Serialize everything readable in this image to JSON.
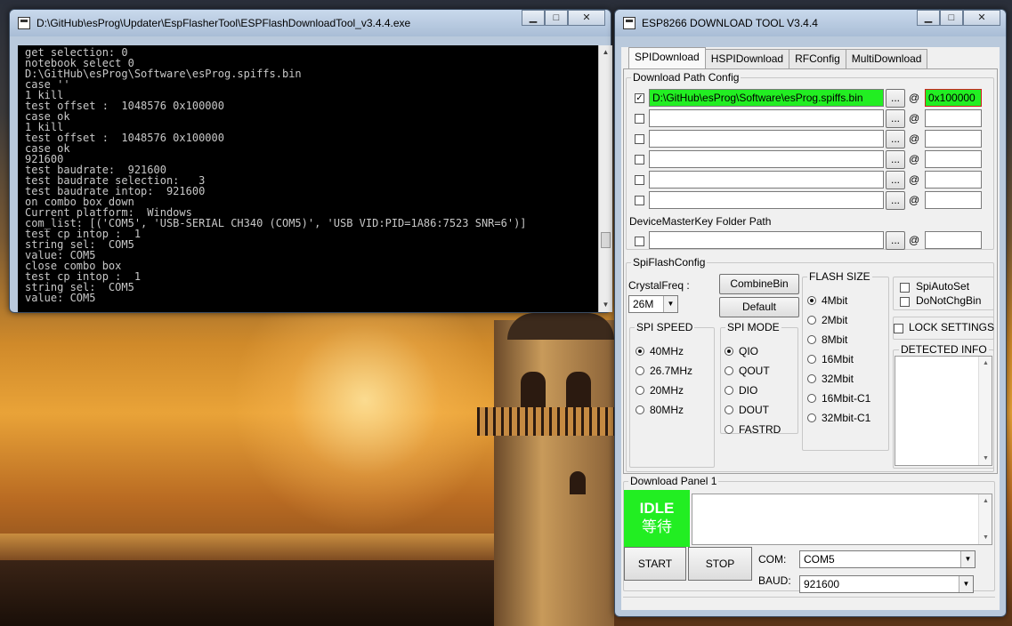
{
  "console_window": {
    "title": "D:\\GitHub\\esProg\\Updater\\EspFlasherTool\\ESPFlashDownloadTool_v3.4.4.exe",
    "lines": [
      "get selection: 0",
      "notebook select 0",
      "D:\\GitHub\\esProg\\Software\\esProg.spiffs.bin",
      "case ''",
      "1 kill",
      "test offset :  1048576 0x100000",
      "case ok",
      "1 kill",
      "test offset :  1048576 0x100000",
      "case ok",
      "921600",
      "test baudrate:  921600",
      "test baudrate selection:   3",
      "test baudrate intop:  921600",
      "on combo box down",
      "Current platform:  Windows",
      "com_list: [('COM5', 'USB-SERIAL CH340 (COM5)', 'USB VID:PID=1A86:7523 SNR=6')]",
      "test cp intop :  1",
      "string sel:  COM5",
      "value: COM5",
      "close combo box",
      "test cp intop :  1",
      "string sel:  COM5",
      "value: COM5"
    ]
  },
  "esp_window": {
    "title": "ESP8266 DOWNLOAD TOOL V3.4.4",
    "tabs": [
      "SPIDownload",
      "HSPIDownload",
      "RFConfig",
      "MultiDownload"
    ],
    "download_path_config": {
      "title": "Download Path Config",
      "rows": [
        {
          "checked": true,
          "path": "D:\\GitHub\\esProg\\Software\\esProg.spiffs.bin",
          "address": "0x100000"
        },
        {
          "checked": false,
          "path": "",
          "address": ""
        },
        {
          "checked": false,
          "path": "",
          "address": ""
        },
        {
          "checked": false,
          "path": "",
          "address": ""
        },
        {
          "checked": false,
          "path": "",
          "address": ""
        },
        {
          "checked": false,
          "path": "",
          "address": ""
        }
      ],
      "browse_label": "...",
      "at_label": "@",
      "device_master_key_label": "DeviceMasterKey Folder Path"
    },
    "spi_flash_config": {
      "title": "SpiFlashConfig",
      "crystal_freq_label": "CrystalFreq :",
      "crystal_freq_value": "26M",
      "combine_bin_label": "CombineBin",
      "default_label": "Default",
      "flash_size": {
        "title": "FLASH SIZE",
        "options": [
          "4Mbit",
          "2Mbit",
          "8Mbit",
          "16Mbit",
          "32Mbit",
          "16Mbit-C1",
          "32Mbit-C1"
        ],
        "selected": "4Mbit"
      },
      "spi_speed": {
        "title": "SPI SPEED",
        "options": [
          "40MHz",
          "26.7MHz",
          "20MHz",
          "80MHz"
        ],
        "selected": "40MHz"
      },
      "spi_mode": {
        "title": "SPI MODE",
        "options": [
          "QIO",
          "QOUT",
          "DIO",
          "DOUT",
          "FASTRD"
        ],
        "selected": "QIO"
      },
      "spi_auto_set_label": "SpiAutoSet",
      "do_not_chg_bin_label": "DoNotChgBin",
      "lock_settings_label": "LOCK SETTINGS",
      "detected_info_label": "DETECTED INFO"
    },
    "download_panel": {
      "title": "Download Panel 1",
      "status": "IDLE",
      "status_sub": "等待",
      "start_label": "START",
      "stop_label": "STOP",
      "com_label": "COM:",
      "com_value": "COM5",
      "baud_label": "BAUD:",
      "baud_value": "921600"
    },
    "colors": {
      "status_idle": "#22ee22",
      "path_highlight": "#22ee22",
      "address_highlight": "#22ee22"
    }
  }
}
